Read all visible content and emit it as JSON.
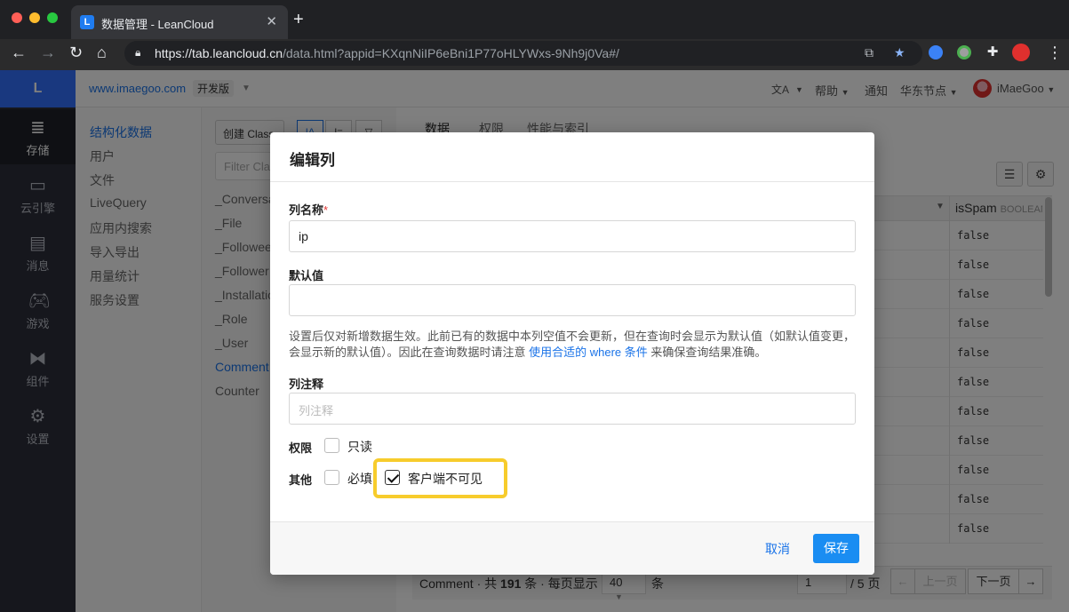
{
  "browser": {
    "tab_title": "数据管理 - LeanCloud",
    "tab_favicon_letter": "L",
    "url_host": "https://tab.leancloud.cn",
    "url_path": "/data.html?appid=KXqnNiIP6eBni1P77oHLYWxs-9Nh9j0Va#/"
  },
  "header": {
    "logo_letter": "L",
    "app_name": "www.imaegoo.com",
    "env_badge": "开发版",
    "translate_icon": "文A",
    "help": "帮助",
    "notify": "通知",
    "region": "华东节点",
    "username": "iMaeGoo"
  },
  "iconbar": {
    "items": [
      {
        "label": "存储",
        "icon": "database-icon"
      },
      {
        "label": "云引擎",
        "icon": "server-icon"
      },
      {
        "label": "消息",
        "icon": "message-icon"
      },
      {
        "label": "游戏",
        "icon": "gamepad-icon"
      },
      {
        "label": "组件",
        "icon": "components-icon"
      },
      {
        "label": "设置",
        "icon": "gear-icon"
      }
    ]
  },
  "subnav": {
    "items": [
      "结构化数据",
      "用户",
      "文件",
      "LiveQuery",
      "应用内搜索",
      "导入导出",
      "用量统计",
      "服务设置"
    ]
  },
  "classes": {
    "create_button": "创建 Class",
    "sort_btn_1": "IA",
    "sort_btn_2": "I=",
    "filter_placeholder": "Filter Class",
    "items": [
      "_Conversation",
      "_File",
      "_Followee",
      "_Follower",
      "_Installation",
      "_Role",
      "_User",
      "Comment",
      "Counter"
    ]
  },
  "main": {
    "tabs": [
      "数据",
      "权限",
      "性能与索引"
    ],
    "column_name": "isSpam",
    "column_type": "BOOLEAN",
    "rows": [
      "false",
      "false",
      "false",
      "false",
      "false",
      "false",
      "false",
      "false",
      "false",
      "false",
      "false"
    ]
  },
  "footer": {
    "class_name": "Comment",
    "total_prefix": " · 共 ",
    "total": "191",
    "total_suffix": " 条 · 每页显示",
    "per_page": "40",
    "per_page_unit": "条",
    "page": "1",
    "page_total": "/ 5 页",
    "prev": "上一页",
    "next": "下一页"
  },
  "modal": {
    "title": "编辑列",
    "name_label": "列名称",
    "required_mark": "*",
    "name_value": "ip",
    "default_label": "默认值",
    "default_value": "",
    "help_text_1": "设置后仅对新增数据生效。此前已有的数据中本列空值不会更新，但在查询时会显示为默认值（如默认值变更，会显示新的默认值）。因此在查询数据时请注意 ",
    "help_link": "使用合适的 where 条件",
    "help_text_2": " 来确保查询结果准确。",
    "comment_label": "列注释",
    "comment_placeholder": "列注释",
    "perm_label": "权限",
    "readonly_label": "只读",
    "readonly_checked": false,
    "other_label": "其他",
    "required_label": "必填",
    "required_checked": false,
    "hidden_label": "客户端不可见",
    "hidden_checked": true,
    "cancel": "取消",
    "save": "保存",
    "highlight_color": "#f7cc2c"
  }
}
